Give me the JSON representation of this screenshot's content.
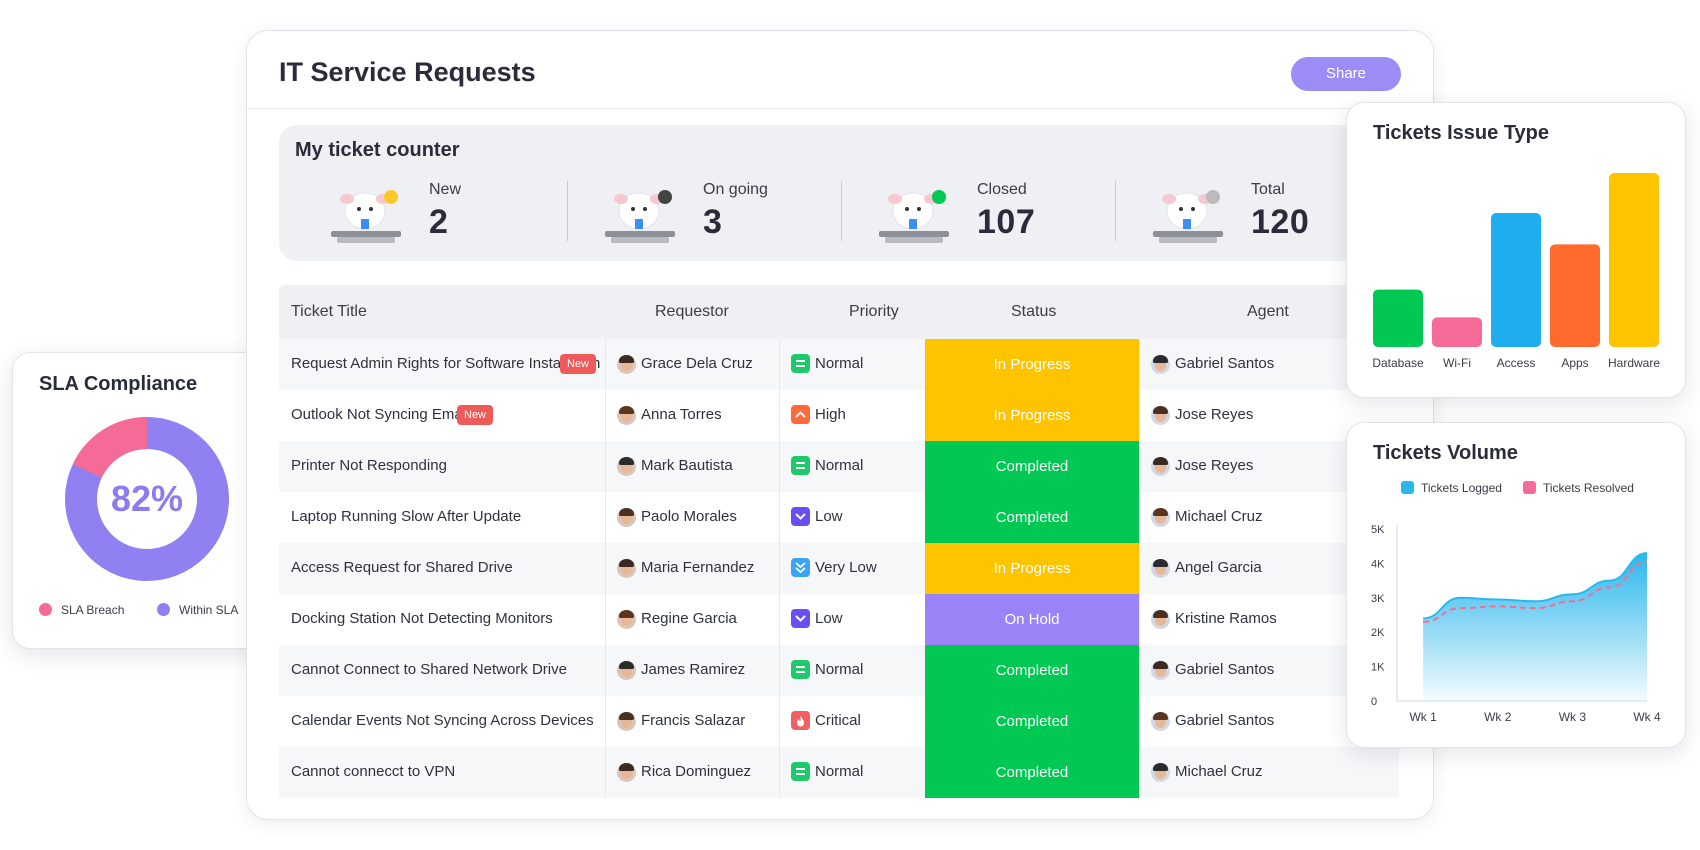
{
  "main": {
    "title": "IT Service Requests",
    "share_label": "Share"
  },
  "counter": {
    "title": "My ticket counter",
    "items": [
      {
        "label": "New",
        "value": "2"
      },
      {
        "label": "On going",
        "value": "3"
      },
      {
        "label": "Closed",
        "value": "107"
      },
      {
        "label": "Total",
        "value": "120"
      }
    ]
  },
  "table": {
    "headers": [
      "Ticket Title",
      "Requestor",
      "Priority",
      "Status",
      "Agent"
    ],
    "new_badge": "New",
    "rows": [
      {
        "title": "Request Admin Rights for Software Installation",
        "is_new": true,
        "requestor": "Grace Dela Cruz",
        "priority": "Normal",
        "status": "In Progress",
        "agent": "Gabriel Santos"
      },
      {
        "title": "Outlook Not Syncing Emails",
        "is_new": true,
        "requestor": "Anna Torres",
        "priority": "High",
        "status": "In Progress",
        "agent": "Jose Reyes"
      },
      {
        "title": "Printer Not Responding",
        "is_new": false,
        "requestor": "Mark Bautista",
        "priority": "Normal",
        "status": "Completed",
        "agent": "Jose Reyes"
      },
      {
        "title": "Laptop Running Slow After Update",
        "is_new": false,
        "requestor": "Paolo Morales",
        "priority": "Low",
        "status": "Completed",
        "agent": "Michael Cruz"
      },
      {
        "title": "Access Request for Shared Drive",
        "is_new": false,
        "requestor": "Maria Fernandez",
        "priority": "Very Low",
        "status": "In Progress",
        "agent": "Angel Garcia"
      },
      {
        "title": "Docking Station Not Detecting Monitors",
        "is_new": false,
        "requestor": "Regine Garcia",
        "priority": "Low",
        "status": "On Hold",
        "agent": "Kristine Ramos"
      },
      {
        "title": "Cannot Connect to Shared Network Drive",
        "is_new": false,
        "requestor": "James Ramirez",
        "priority": "Normal",
        "status": "Completed",
        "agent": "Gabriel Santos"
      },
      {
        "title": "Calendar Events Not Syncing Across Devices",
        "is_new": false,
        "requestor": "Francis Salazar",
        "priority": "Critical",
        "status": "Completed",
        "agent": "Gabriel Santos"
      },
      {
        "title": "Cannot connecct to VPN",
        "is_new": false,
        "requestor": "Rica Dominguez",
        "priority": "Normal",
        "status": "Completed",
        "agent": "Michael Cruz"
      }
    ]
  },
  "colors": {
    "accent": "#9b8cf6",
    "status_in_progress": "#ffc400",
    "status_completed": "#00c853",
    "status_on_hold": "#9b83f7",
    "priority_normal": "#1dc96b",
    "priority_high": "#ff6a3d",
    "priority_low": "#6a4ff0",
    "priority_very_low": "#3aa5f5",
    "priority_critical": "#f06161",
    "new_badge": "#ef5a5a"
  },
  "sla": {
    "title": "SLA Compliance",
    "percent_label": "82%",
    "within_fraction": 0.82,
    "legend": [
      {
        "label": "SLA Breach",
        "color": "#f56a96"
      },
      {
        "label": "Within SLA",
        "color": "#9081f3"
      }
    ]
  },
  "chart_data": [
    {
      "type": "bar",
      "title": "Tickets Issue Type",
      "categories": [
        "Database",
        "Wi-Fi",
        "Access",
        "Apps",
        "Hardware"
      ],
      "values": [
        33,
        17,
        77,
        59,
        100
      ],
      "colors": [
        "#00c853",
        "#f56a96",
        "#1eaef0",
        "#ff6a2d",
        "#ffc400"
      ],
      "ylim": [
        0,
        100
      ],
      "grid": false
    },
    {
      "type": "area",
      "title": "Tickets Volume",
      "x": [
        "Wk 1",
        "Wk 2",
        "Wk 3",
        "Wk 4"
      ],
      "yticks": [
        "0",
        "1K",
        "2K",
        "3K",
        "4K",
        "5K"
      ],
      "ylim": [
        0,
        5000
      ],
      "legend_position": "top",
      "series": [
        {
          "name": "Tickets Logged",
          "color": "#2bb7ec",
          "points": [
            [
              1,
              2400
            ],
            [
              1.5,
              3000
            ],
            [
              2,
              2950
            ],
            [
              2.5,
              2900
            ],
            [
              3,
              3100
            ],
            [
              3.5,
              3500
            ],
            [
              4,
              4300
            ]
          ]
        },
        {
          "name": "Tickets Resolved",
          "color": "#f56a96",
          "points": [
            [
              1,
              2300
            ],
            [
              1.5,
              2700
            ],
            [
              2,
              2750
            ],
            [
              2.5,
              2700
            ],
            [
              3,
              2900
            ],
            [
              3.5,
              3300
            ],
            [
              4,
              4050
            ]
          ]
        }
      ]
    }
  ]
}
